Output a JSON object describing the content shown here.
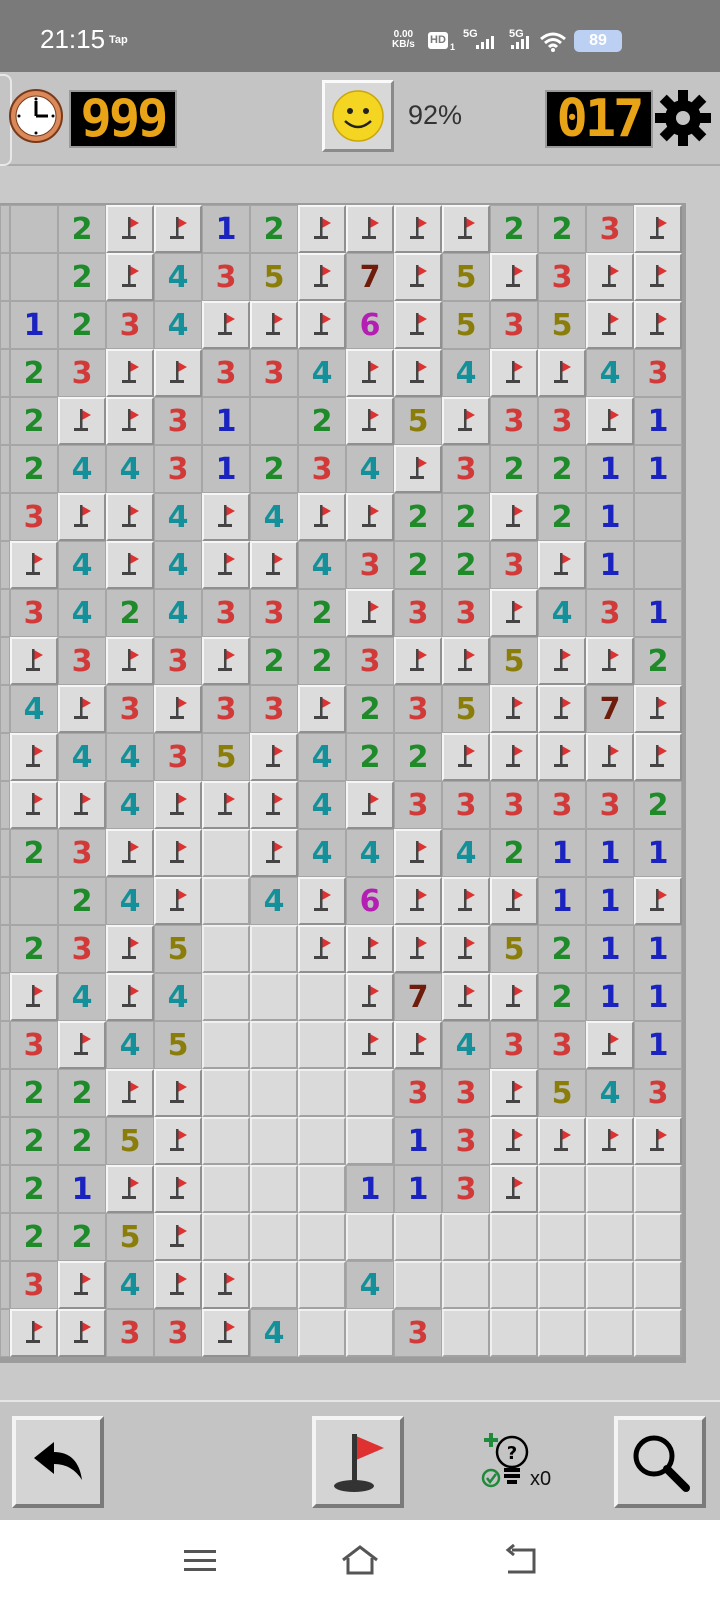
{
  "status_bar": {
    "time": "21:15",
    "tap": "Tap",
    "speed_value": "0.00",
    "speed_unit": "KB/s",
    "hd": "HD",
    "hd_sub": "1",
    "net1": "5G",
    "net2": "5G",
    "battery": "89"
  },
  "hud": {
    "timer": "999",
    "progress": "92%",
    "mines_left": "017",
    "icons": [
      "clock-icon",
      "smiley-icon",
      "gear-icon"
    ]
  },
  "board": {
    "legend": "F = flag, . = open blank, _ = covered, digits = revealed numbers",
    "rows": [
      ". 2 F F 1 2 F F F F 2 2 3 F",
      ". 2 F 4 3 5 F 7 F 5 F 3 F F",
      "1 2 3 4 F F F 6 F 5 3 5 F F",
      "2 3 F F 3 3 4 F F 4 F F 4 3",
      "2 F F 3 1 . 2 F 5 F 3 3 F 1",
      "2 4 4 3 1 2 3 4 F 3 2 2 1 1",
      "3 F F 4 F 4 F F 2 2 F 2 1 .",
      "F 4 F 4 F F 4 3 2 2 3 F 1 .",
      "3 4 2 4 3 3 2 F 3 3 F 4 3 1",
      "F 3 F 3 F 2 2 3 F F 5 F F 2",
      "4 F 3 F 3 3 F 2 3 5 F F 7 F",
      "F 4 4 3 5 F 4 2 2 F F F F F",
      "F F 4 F F F 4 F 3 3 3 3 3 2",
      "2 3 F F _ F 4 4 F 4 2 1 1 1",
      ". 2 4 F _ 4 F 6 F F F 1 1 F",
      "2 3 F 5 _ _ F F F F 5 2 1 1",
      "F 4 F 4 _ _ _ F 7 F F 2 1 1",
      "3 F 4 5 _ _ _ F F 4 3 3 F 1",
      "2 2 F F _ _ _ _ 3 3 F 5 4 3",
      "2 2 5 F _ _ _ _ 1 3 F F F F",
      "2 1 F F _ _ _ 1 1 3 F _ _ _",
      "2 2 5 F _ _ _ _ _ _ _ _ _ _",
      "3 F 4 F F _ _ 4 _ _ _ _ _ _",
      "F F 3 3 F 4 _ _ 3 _ _ _ _ _"
    ]
  },
  "toolbar": {
    "hint_count": "x0",
    "icons": [
      "undo-icon",
      "flag-mode-icon",
      "hint-icon",
      "zoom-icon"
    ]
  },
  "nav": {
    "icons": [
      "menu-icon",
      "home-icon",
      "back-icon"
    ]
  }
}
